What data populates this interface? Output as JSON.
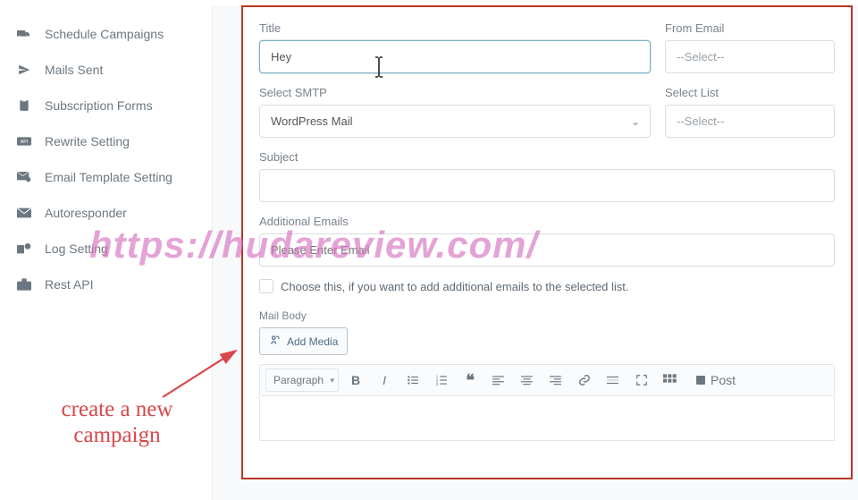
{
  "sidebar": {
    "items": [
      {
        "label": "Schedule Campaigns",
        "icon": "truck-icon"
      },
      {
        "label": "Mails Sent",
        "icon": "paper-plane-icon"
      },
      {
        "label": "Subscription Forms",
        "icon": "clipboard-icon"
      },
      {
        "label": "Rewrite Setting",
        "icon": "api-icon"
      },
      {
        "label": "Email Template Setting",
        "icon": "envelope-gear-icon"
      },
      {
        "label": "Autoresponder",
        "icon": "envelope-icon"
      },
      {
        "label": "Log Setting",
        "icon": "log-icon"
      },
      {
        "label": "Rest API",
        "icon": "briefcase-icon"
      }
    ]
  },
  "form": {
    "title_label": "Title",
    "title_value": "Hey",
    "from_email_label": "From Email",
    "from_email_value": "--Select--",
    "smtp_label": "Select SMTP",
    "smtp_value": "WordPress Mail",
    "list_label": "Select List",
    "list_value": "--Select--",
    "subject_label": "Subject",
    "subject_value": "",
    "additional_label": "Additional Emails",
    "additional_placeholder": "Please Enter Email",
    "checkbox_label": "Choose this, if you want to add additional emails to the selected list.",
    "mailbody_label": "Mail Body",
    "add_media_label": "Add Media"
  },
  "editor": {
    "paragraph_label": "Paragraph",
    "post_label": "Post"
  },
  "annotation": {
    "text": "create a new campaign"
  },
  "watermark": {
    "text": "https://hudareview.com/"
  }
}
